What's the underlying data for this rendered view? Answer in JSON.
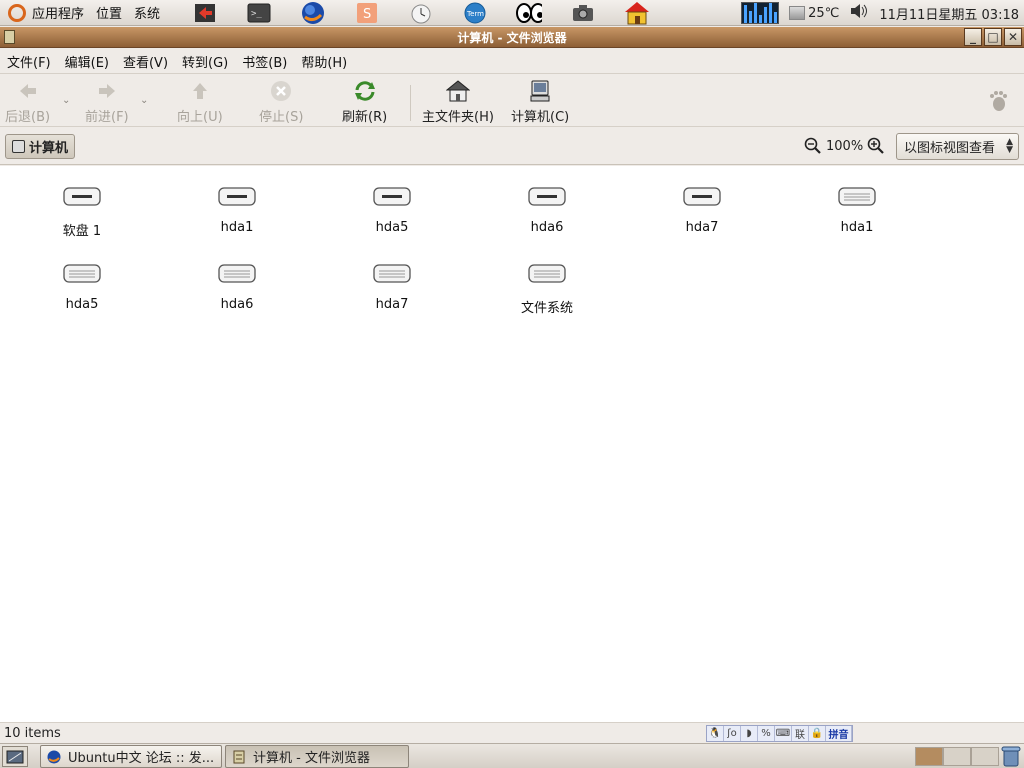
{
  "top_panel": {
    "menus": [
      "应用程序",
      "位置",
      "系统"
    ],
    "launchers": [
      "log-out-icon",
      "terminal-icon",
      "firefox-icon",
      "bookmarks-icon",
      "clock-icon",
      "term-icon",
      "xeyes-icon",
      "camera-icon",
      "home-house-icon"
    ],
    "temperature": "25℃",
    "datetime": "11月11日星期五 03:18"
  },
  "window": {
    "title": "计算机 - 文件浏览器"
  },
  "menubar": [
    "文件(F)",
    "编辑(E)",
    "查看(V)",
    "转到(G)",
    "书签(B)",
    "帮助(H)"
  ],
  "toolbar": {
    "back": "后退(B)",
    "forward": "前进(F)",
    "up": "向上(U)",
    "stop": "停止(S)",
    "reload": "刷新(R)",
    "home": "主文件夹(H)",
    "computer": "计算机(C)"
  },
  "location": {
    "crumb": "计算机",
    "zoom": "100%",
    "view_mode": "以图标视图查看"
  },
  "drives": [
    "软盘 1",
    "hda1",
    "hda5",
    "hda6",
    "hda7",
    "hda1",
    "hda5",
    "hda6",
    "hda7",
    "文件系统"
  ],
  "status": {
    "items": "10 items",
    "ime_labels": [
      "联",
      "拼音"
    ]
  },
  "taskbar": {
    "tasks": [
      "Ubuntu中文 论坛 :: 发...",
      "计算机 - 文件浏览器"
    ]
  }
}
